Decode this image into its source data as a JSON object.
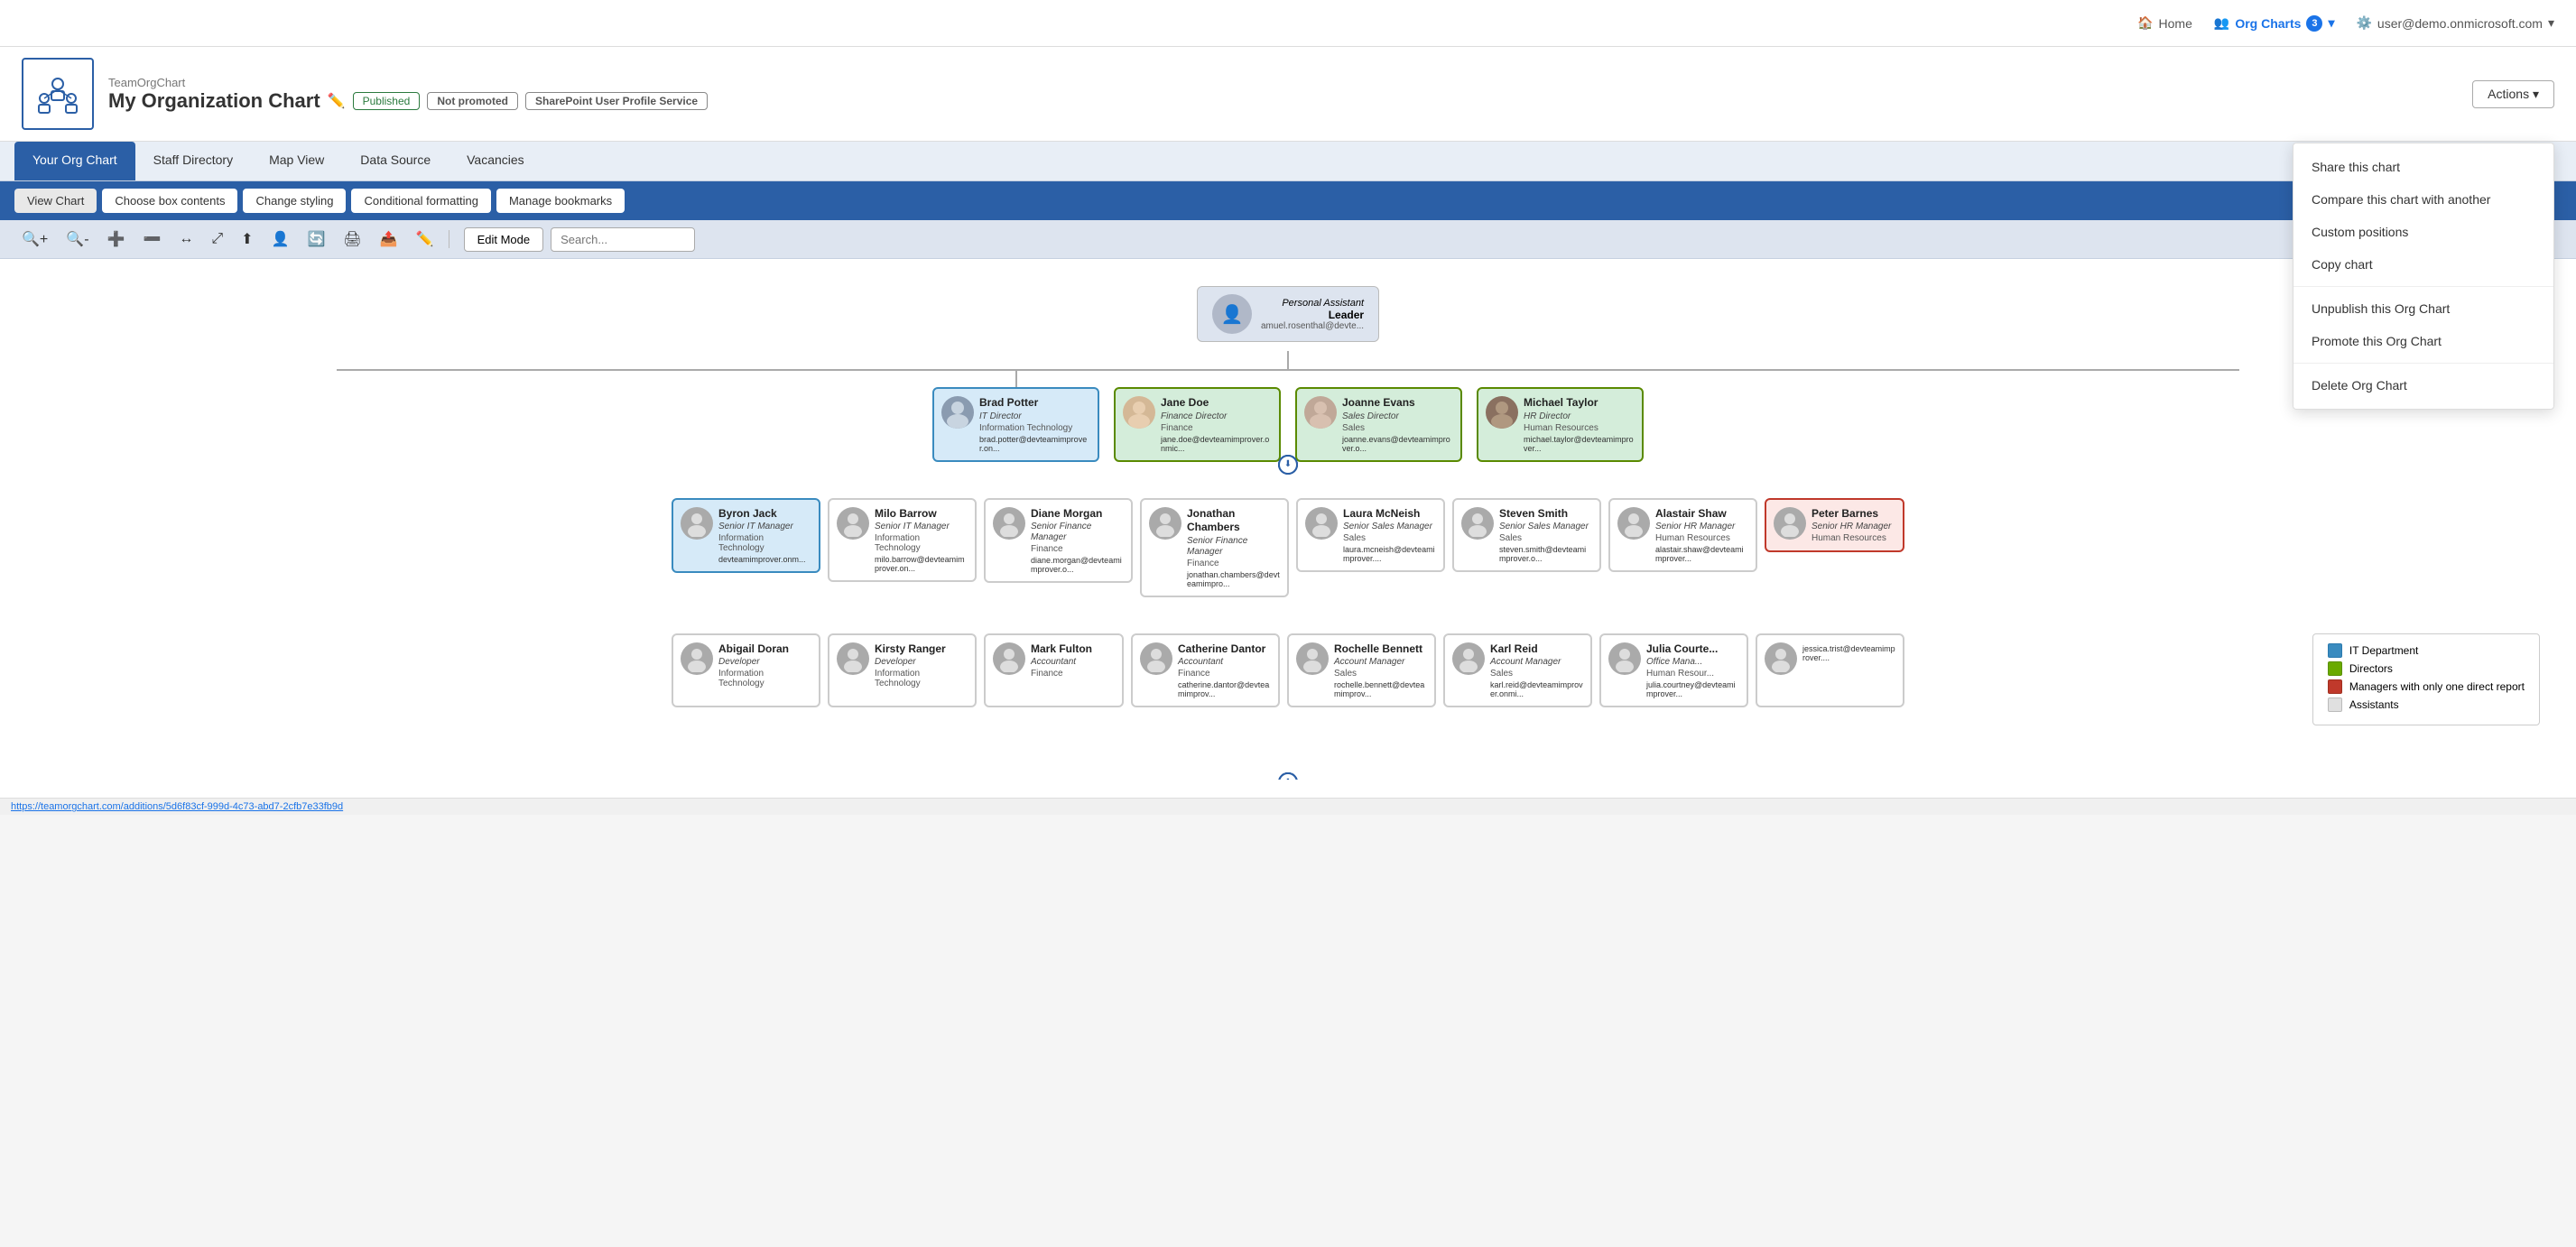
{
  "nav": {
    "home_label": "Home",
    "org_charts_label": "Org Charts",
    "org_charts_count": "3",
    "user_label": "user@demo.onmicrosoft.com"
  },
  "header": {
    "brand": "TeamOrgChart",
    "title": "My Organization Chart",
    "badge_published": "Published",
    "badge_not_promoted": "Not promoted",
    "badge_sharepoint": "SharePoint User Profile Service",
    "actions_label": "Actions ▾"
  },
  "actions_menu": {
    "items": [
      "Share this chart",
      "Compare this chart with another",
      "Custom positions",
      "Copy chart",
      null,
      "Unpublish this Org Chart",
      "Promote this Org Chart",
      null,
      "Delete Org Chart"
    ]
  },
  "tabs": {
    "main": [
      {
        "label": "Your Org Chart",
        "active": true
      },
      {
        "label": "Staff Directory"
      },
      {
        "label": "Map View"
      },
      {
        "label": "Data Source"
      },
      {
        "label": "Vacancies"
      }
    ],
    "sub": [
      {
        "label": "View Chart",
        "active": true
      },
      {
        "label": "Choose box contents"
      },
      {
        "label": "Change styling"
      },
      {
        "label": "Conditional formatting"
      },
      {
        "label": "Manage bookmarks"
      }
    ]
  },
  "toolbar": {
    "edit_mode_label": "Edit Mode",
    "search_placeholder": "Search..."
  },
  "chart": {
    "top_person": {
      "label": "Personal Assistant",
      "sub": "Leader",
      "email": "amuel.rosenthal@devte..."
    },
    "directors": [
      {
        "name": "Brad Potter",
        "title": "IT Director",
        "dept": "Information Technology",
        "email": "brad.potter@devteamimprover.on...",
        "style": "it",
        "has_photo": true
      },
      {
        "name": "Jane Doe",
        "title": "Finance Director",
        "dept": "Finance",
        "email": "jane.doe@devteamimprover.onmic...",
        "style": "director",
        "has_photo": true
      },
      {
        "name": "Joanne Evans",
        "title": "Sales Director",
        "dept": "Sales",
        "email": "joanne.evans@devteamimprover.o...",
        "style": "director",
        "has_photo": true
      },
      {
        "name": "Michael Taylor",
        "title": "HR Director",
        "dept": "Human Resources",
        "email": "michael.taylor@devteamimprover...",
        "style": "director",
        "has_photo": false
      }
    ],
    "managers": [
      {
        "name": "Byron Jack",
        "title": "Senior IT Manager",
        "dept": "Information Technology",
        "email": "devteamimprover.onm...",
        "style": "it"
      },
      {
        "name": "Milo Barrow",
        "title": "Senior IT Manager",
        "dept": "Information Technology",
        "email": "milo.barrow@devteamimprover.on...",
        "style": "plain"
      },
      {
        "name": "Diane Morgan",
        "title": "Senior Finance Manager",
        "dept": "Finance",
        "email": "diane.morgan@devteamimprover.o...",
        "style": "plain"
      },
      {
        "name": "Jonathan Chambers",
        "title": "Senior Finance Manager",
        "dept": "Finance",
        "email": "jonathan.chambers@devteamimpro...",
        "style": "plain"
      },
      {
        "name": "Laura McNeish",
        "title": "Senior Sales Manager",
        "dept": "Sales",
        "email": "laura.mcneish@devteamimprover....",
        "style": "plain"
      },
      {
        "name": "Steven Smith",
        "title": "Senior Sales Manager",
        "dept": "Sales",
        "email": "steven.smith@devteamimprover.o...",
        "style": "plain"
      },
      {
        "name": "Alastair Shaw",
        "title": "Senior HR Manager",
        "dept": "Human Resources",
        "email": "alastair.shaw@devteamimprover...",
        "style": "plain"
      },
      {
        "name": "Peter Barnes",
        "title": "Senior HR Manager",
        "dept": "Human Resources",
        "email": "",
        "style": "red"
      }
    ],
    "reports": [
      {
        "name": "Abigail Doran",
        "title": "Developer",
        "dept": "Information Technology",
        "email": ""
      },
      {
        "name": "Kirsty Ranger",
        "title": "Developer",
        "dept": "Information Technology",
        "email": ""
      },
      {
        "name": "Mark Fulton",
        "title": "Accountant",
        "dept": "Finance",
        "email": ""
      },
      {
        "name": "Catherine Dantor",
        "title": "Accountant",
        "dept": "Finance",
        "email": "catherine.dantor@devteamimprov..."
      },
      {
        "name": "Rochelle Bennett",
        "title": "Account Manager",
        "dept": "Sales",
        "email": "rochelle.bennett@devteamimprov..."
      },
      {
        "name": "Karl Reid",
        "title": "Account Manager",
        "dept": "Sales",
        "email": "karl.reid@devteamimprover.onmi..."
      },
      {
        "name": "Julia Courte...",
        "title": "Office Mana...",
        "dept": "Human Resour...",
        "email": "julia.courtney@devteamimprover..."
      },
      {
        "name": "jessica.trist@devteamimprover....",
        "title": "",
        "dept": "",
        "email": ""
      }
    ]
  },
  "legend": {
    "items": [
      {
        "label": "IT Department",
        "color": "#3a8bbf"
      },
      {
        "label": "Directors",
        "color": "#6aaa00"
      },
      {
        "label": "Managers with only one direct report",
        "color": "#c0392b"
      },
      {
        "label": "Assistants",
        "color": "#e0e0e0"
      }
    ]
  },
  "status_bar": {
    "url": "https://teamorgchart.com/additions/5d6f83cf-999d-4c73-abd7-2cfb7e33fb9d"
  }
}
